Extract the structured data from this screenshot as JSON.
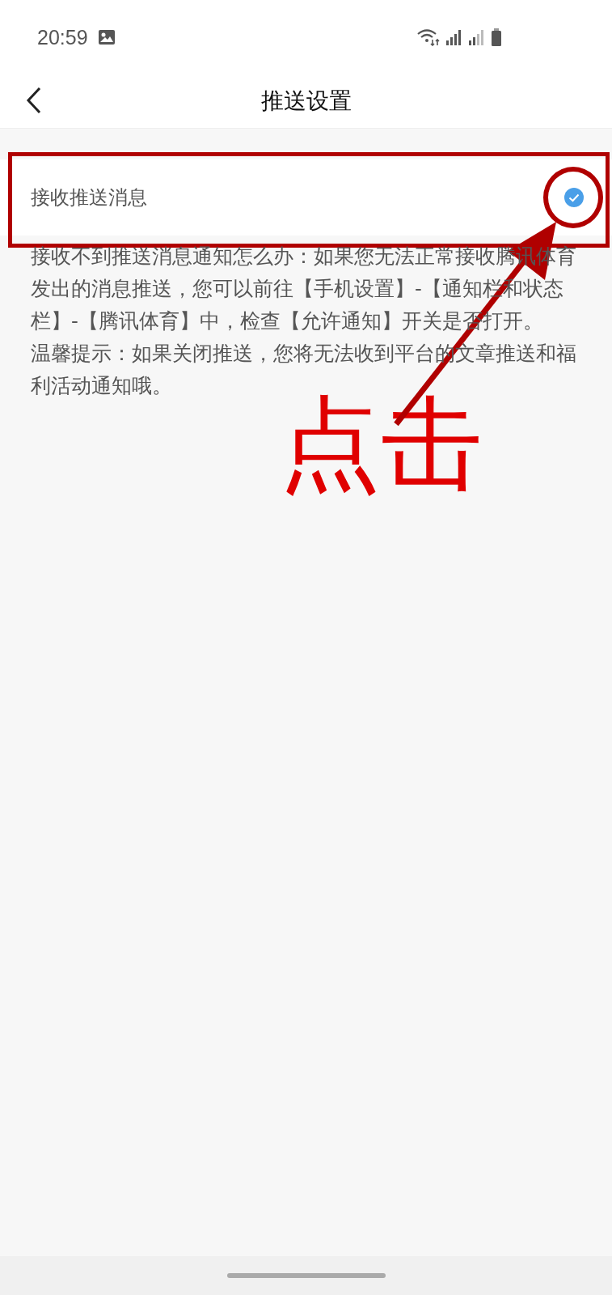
{
  "status_bar": {
    "time": "20:59"
  },
  "header": {
    "title": "推送设置"
  },
  "setting": {
    "label": "接收推送消息",
    "checked": true
  },
  "help": [
    "接收不到推送消息通知怎么办：如果您无法正常接收腾讯体育发出的消息推送，您可以前往【手机设置】-【通知栏和状态栏】-【腾讯体育】中，检查【允许通知】开关是否打开。",
    "温馨提示：如果关闭推送，您将无法收到平台的文章推送和福利活动通知哦。"
  ],
  "annotation": {
    "label": "点击"
  }
}
